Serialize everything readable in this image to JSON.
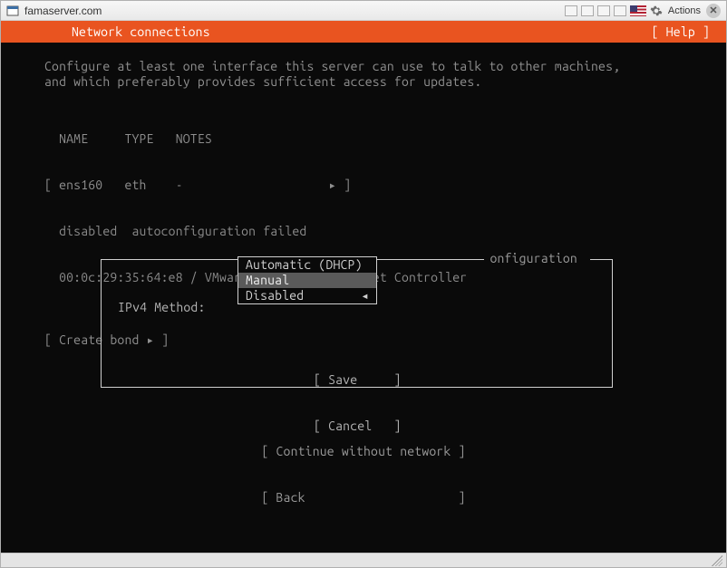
{
  "window": {
    "title": "famaserver.com",
    "actions_label": "Actions"
  },
  "header": {
    "title": "Network connections",
    "help": "[ Help ]"
  },
  "intro": "Configure at least one interface this server can use to talk to other machines,\nand which preferably provides sufficient access for updates.",
  "iface_table": {
    "headers": "  NAME     TYPE   NOTES",
    "row": "[ ens160   eth    -                    ▸ ]",
    "status": "  disabled  autoconfiguration failed",
    "mac": "  00:0c:29:35:64:e8 / VMware / VMXNET3 Ethernet Controller"
  },
  "create_bond": "[ Create bond ▸ ]",
  "dialog": {
    "title_suffix": "onfiguration ",
    "label": "IPv4 Method:",
    "options": {
      "auto": "Automatic (DHCP)",
      "manual": "Manual",
      "disabled": "Disabled"
    },
    "indicator": "◂",
    "buttons": {
      "save": "[ Save     ]",
      "cancel": "[ Cancel   ]"
    }
  },
  "footer": {
    "continue": "[ Continue without network ]",
    "back": "[ Back                     ]"
  }
}
